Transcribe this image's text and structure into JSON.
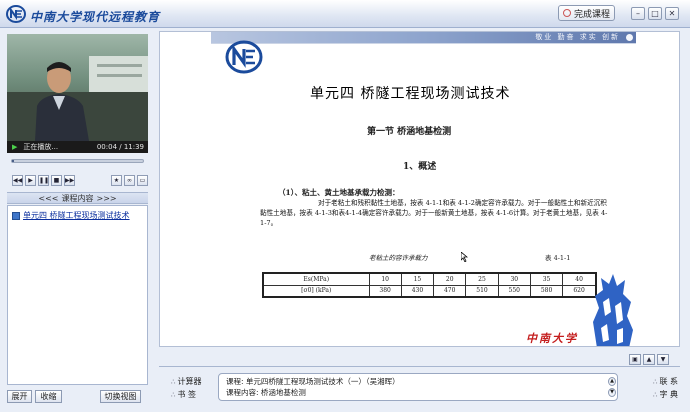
{
  "app": {
    "brand": "中南大学现代远程教育",
    "finish_button": "完成课程"
  },
  "player": {
    "status": "正在播放...",
    "time": "00:04 / 11:39",
    "left_buttons": {
      "expand": "展开",
      "collapse": "收缩",
      "switch_view": "切换视图"
    }
  },
  "toc": {
    "header": "课程内容",
    "items": [
      {
        "label": "单元四 桥隧工程现场测试技术"
      }
    ]
  },
  "document": {
    "banner_text": "敬业  勤奋  求实  创新",
    "title": "单元四    桥隧工程现场测试技术",
    "section": "第一节    桥涵地基检测",
    "subsection": "1、概述",
    "para_head": "（1）、粘土、黄土地基承载力检测：",
    "para_body": "对于老粘土和残积黏性土地基，按表 4-1-1和表 4-1-2确定容许承载力。对于一般黏性土和新近沉积黏性土地基，按表 4-1-3和表4-1-4确定容许承载力。对于一般新黄土地基，按表 4-1-6计算。对于老黄土地基，见表 4-1-7。",
    "table_caption": "老粘土的容许承载力",
    "table_number": "表 4-1-1",
    "table": {
      "rows": [
        [
          "Es(MPa)",
          "10",
          "15",
          "20",
          "25",
          "30",
          "35",
          "40"
        ],
        [
          "[σ0] (kPa)",
          "380",
          "430",
          "470",
          "510",
          "550",
          "580",
          "620"
        ]
      ]
    },
    "seal_text": "中南大学"
  },
  "bottom": {
    "calculator": "计算器",
    "bookmark": "书  签",
    "course_line": "课程: 单元四桥隧工程现场测试技术（一）（吴湘晖）",
    "content_line": "课程内容: 桥涵地基检测",
    "contact": "联  系",
    "dictionary": "字  典"
  }
}
